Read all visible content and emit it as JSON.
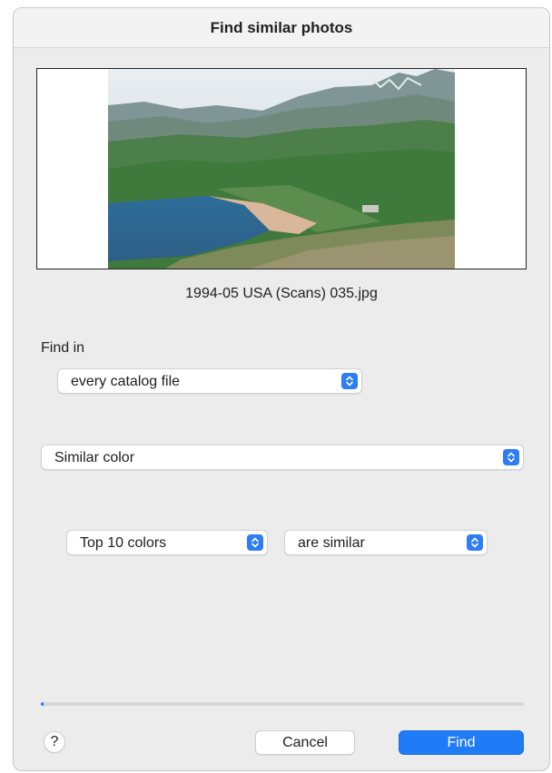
{
  "dialog": {
    "title": "Find similar photos",
    "filename": "1994-05 USA (Scans) 035.jpg",
    "find_in_label": "Find in",
    "find_in_value": "every catalog file",
    "criterion_value": "Similar color",
    "colors_value": "Top 10 colors",
    "match_value": "are similar",
    "progress": 0.005,
    "help_label": "?",
    "cancel_label": "Cancel",
    "find_label": "Find"
  },
  "colors": {
    "accent": "#2f7df6",
    "dialog_bg": "#ececec"
  },
  "icons": [
    "popup-arrows-icon",
    "help-icon"
  ]
}
